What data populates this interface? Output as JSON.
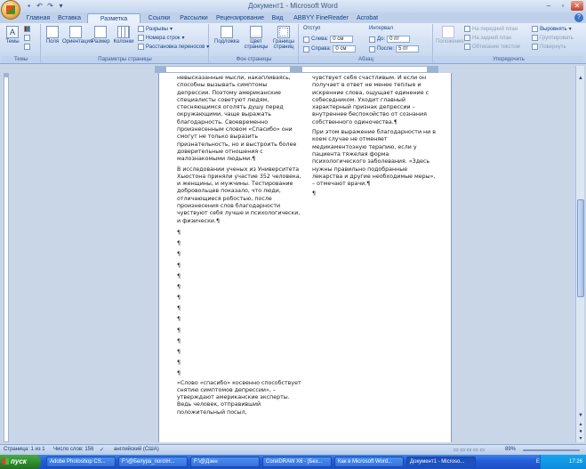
{
  "window": {
    "title": "Документ1 - Microsoft Word"
  },
  "tabs": [
    "Главная",
    "Вставка",
    "Разметка страницы",
    "Ссылки",
    "Рассылки",
    "Рецензирование",
    "Вид",
    "ABBYY FineReader 11",
    "Acrobat"
  ],
  "active_tab": "Разметка страницы",
  "ribbon": {
    "themes": {
      "label": "Темы",
      "button": "Темы"
    },
    "page_setup": {
      "label": "Параметры страницы",
      "fields": "Поля",
      "orientation": "Ориентация",
      "size": "Размер",
      "columns": "Колонки",
      "breaks": "Разрывы",
      "line_numbers": "Номера строк",
      "hyphenation": "Расстановка переносов"
    },
    "page_background": {
      "label": "Фон страницы",
      "watermark": "Подложка",
      "page_color": "Цвет страницы",
      "page_borders": "Границы страниц"
    },
    "paragraph": {
      "label": "Абзац",
      "indent": "Отступ",
      "spacing": "Интервал",
      "left_label": "Слева:",
      "left_value": "0 см",
      "right_label": "Справа:",
      "right_value": "0 см",
      "before_label": "До:",
      "before_value": "0 пт",
      "after_label": "После:",
      "after_value": "5 пт"
    },
    "arrange": {
      "label": "Упорядочить",
      "position": "Положение",
      "bring_front": "На передний план",
      "send_back": "На задний план",
      "text_wrap": "Обтекание текстом",
      "align": "Выровнять",
      "group": "Группировать",
      "rotate": "Повернуть"
    }
  },
  "document": {
    "col1_paragraphs": [
      "невысказанные мысли, накапливаясь, способны вызывать симптомы депрессии. Поэтому американские специалисты советуют людям, стесняющимся оголять душу перед окружающими, чаще выражать благодарность. Своевременно произнесенным словом «Спасибо» они смогут не только выразить признательность, но и выстроить более доверительные отношения с малознакомыми людьми.¶",
      "В исследовании ученых из Университета Хьюстона приняли участие 352 человека, и женщины, и мужчины. Тестирование добровольцев показало, что люди, отличающиеся робостью, после произнесения слов благодарности чувствуют себя лучше и психологически, и физически.¶"
    ],
    "pilcrow_count": 14,
    "col1_tail": "«Слово «спасибо» косвенно способствует снятию симптомов депрессии», – утверждают американские эксперты. Ведь человек, отправивший положительный посыл,",
    "col2_paragraphs": [
      "чувствует себя счастливым. И если он получает в ответ не менее теплые и искренние слова, ощущает единение с собеседником. Уходит главный характерный признак депрессии – внутреннее беспокойство от сознания собственного одиночества.¶",
      "При этом выражение благодарности ни в коем случае не отменяет медикаментозную терапию, если у пациента тяжелая форма психологического заболевания. «Здесь нужны правильно подобранные лекарства и другие необходимые меры», – отмечают врачи.¶",
      "¶"
    ]
  },
  "status": {
    "page": "Страница: 1 из 1",
    "words": "Число слов: 156",
    "language": "английский (США)",
    "zoom": "89%"
  },
  "taskbar": {
    "start": "пуск",
    "tasks": [
      "Adobe Photoshop CS...",
      "F:\\@Белура_пого\\Н...",
      "F:\\@Дзен",
      "CorelDRAW X6 - [Без...",
      "Как в Microsoft Word...",
      "Документ1 - Microso..."
    ],
    "active_task": 5,
    "lang": "EN",
    "time": "17:26"
  }
}
